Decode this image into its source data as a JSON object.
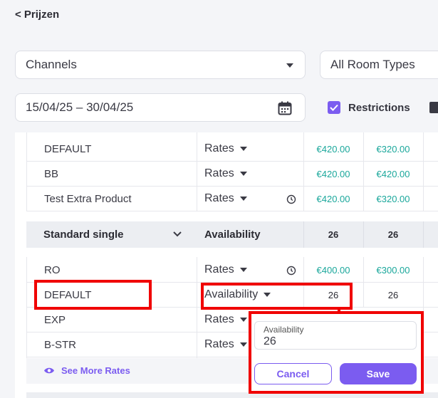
{
  "back_link": "< Prijzen",
  "filters": {
    "channels": "Channels",
    "room_types": "All Room Types",
    "date_range": "15/04/25 – 30/04/25",
    "restrictions_label": "Restrictions",
    "restrictions_checked": true
  },
  "rows_top": [
    {
      "name": "DEFAULT",
      "type": "Rates",
      "values": [
        "€420.00",
        "€320.00"
      ],
      "history": false
    },
    {
      "name": "BB",
      "type": "Rates",
      "values": [
        "€420.00",
        "€420.00"
      ],
      "history": false
    },
    {
      "name": "Test Extra Product",
      "type": "Rates",
      "values": [
        "€420.00",
        "€320.00"
      ],
      "history": true
    }
  ],
  "group": {
    "name": "Standard single",
    "type": "Availability",
    "values": [
      "26",
      "26"
    ]
  },
  "rows_bottom": [
    {
      "name": "RO",
      "type": "Rates",
      "values": [
        "€400.00",
        "€300.00"
      ],
      "history": true
    },
    {
      "name": "DEFAULT",
      "type": "Availability",
      "values": [
        "26",
        "26"
      ],
      "history": false
    },
    {
      "name": "EXP",
      "type": "Rates",
      "values": [],
      "history": false
    },
    {
      "name": "B-STR",
      "type": "Rates",
      "values": [],
      "history": false
    }
  ],
  "see_more": "See More Rates",
  "popup": {
    "field_label": "Availability",
    "field_value": "26",
    "cancel": "Cancel",
    "save": "Save"
  },
  "colors": {
    "accent": "#7b5cf0",
    "price": "#1aa79b",
    "highlight": "#f00000"
  }
}
